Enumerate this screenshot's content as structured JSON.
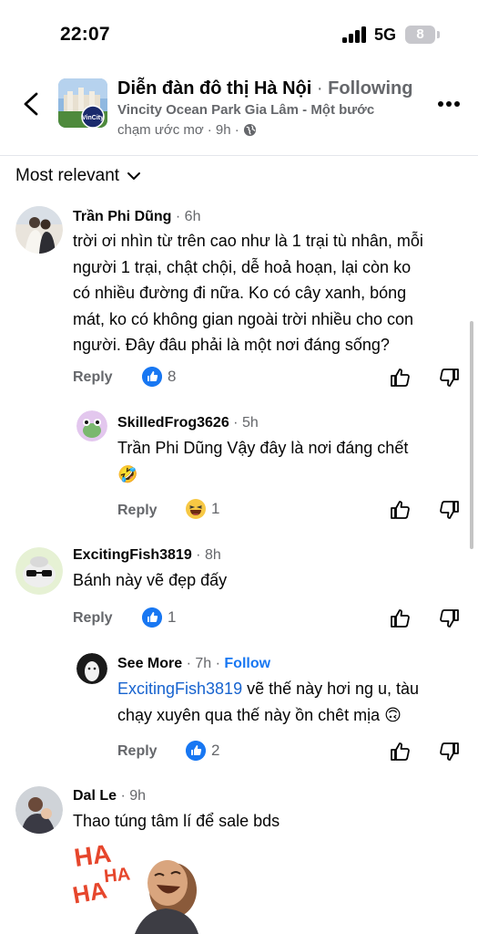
{
  "status_bar": {
    "time": "22:07",
    "network": "5G",
    "battery": "8"
  },
  "header": {
    "group_name": "Diễn đàn đô thị Hà Nội",
    "separator": "·",
    "follow_state": "Following",
    "post_title": "Vincity Ocean Park Gia Lâm - Một bước",
    "post_title_cont": "chạm ước mơ",
    "post_time": "· 9h ·"
  },
  "sort": {
    "label": "Most relevant"
  },
  "comments": [
    {
      "author": "Trần Phi Dũng",
      "time": "· 6h",
      "lines": [
        "trời ơi nhìn từ trên cao như là 1 trại tù nhân, mỗi",
        "người 1 trại, chật chội, dễ hoả hoạn, lại còn ko",
        "có nhiều đường đi nữa. Ko có cây xanh, bóng",
        "mát, ko có không gian ngoài trời nhiều cho con",
        "người. Đây đâu phải là một nơi đáng sống?"
      ],
      "reply_label": "Reply",
      "reactions": "8"
    },
    {
      "author": "SkilledFrog3626",
      "time": "· 5h",
      "lines": [
        "Trần Phi Dũng Vậy đây là nơi đáng chết",
        "🤣"
      ],
      "reply_label": "Reply",
      "reactions": "1"
    },
    {
      "author": "ExcitingFish3819",
      "time": "· 8h",
      "lines": [
        "Bánh này vẽ đẹp đấy"
      ],
      "reply_label": "Reply",
      "reactions": "1"
    },
    {
      "author": "See More",
      "time": "· 7h ·",
      "follow": "Follow",
      "mention": "ExcitingFish3819",
      "line1_rest": " vẽ thế này hơi ng u, tàu",
      "line2": "chạy xuyên qua thế này ồn chêt mịa 🙃",
      "reply_label": "Reply",
      "reactions": "2"
    },
    {
      "author": "Dal Le",
      "time": "· 9h",
      "lines": [
        "Thao túng tâm lí để sale bds"
      ],
      "sticker_text": "HA HA HA"
    }
  ]
}
